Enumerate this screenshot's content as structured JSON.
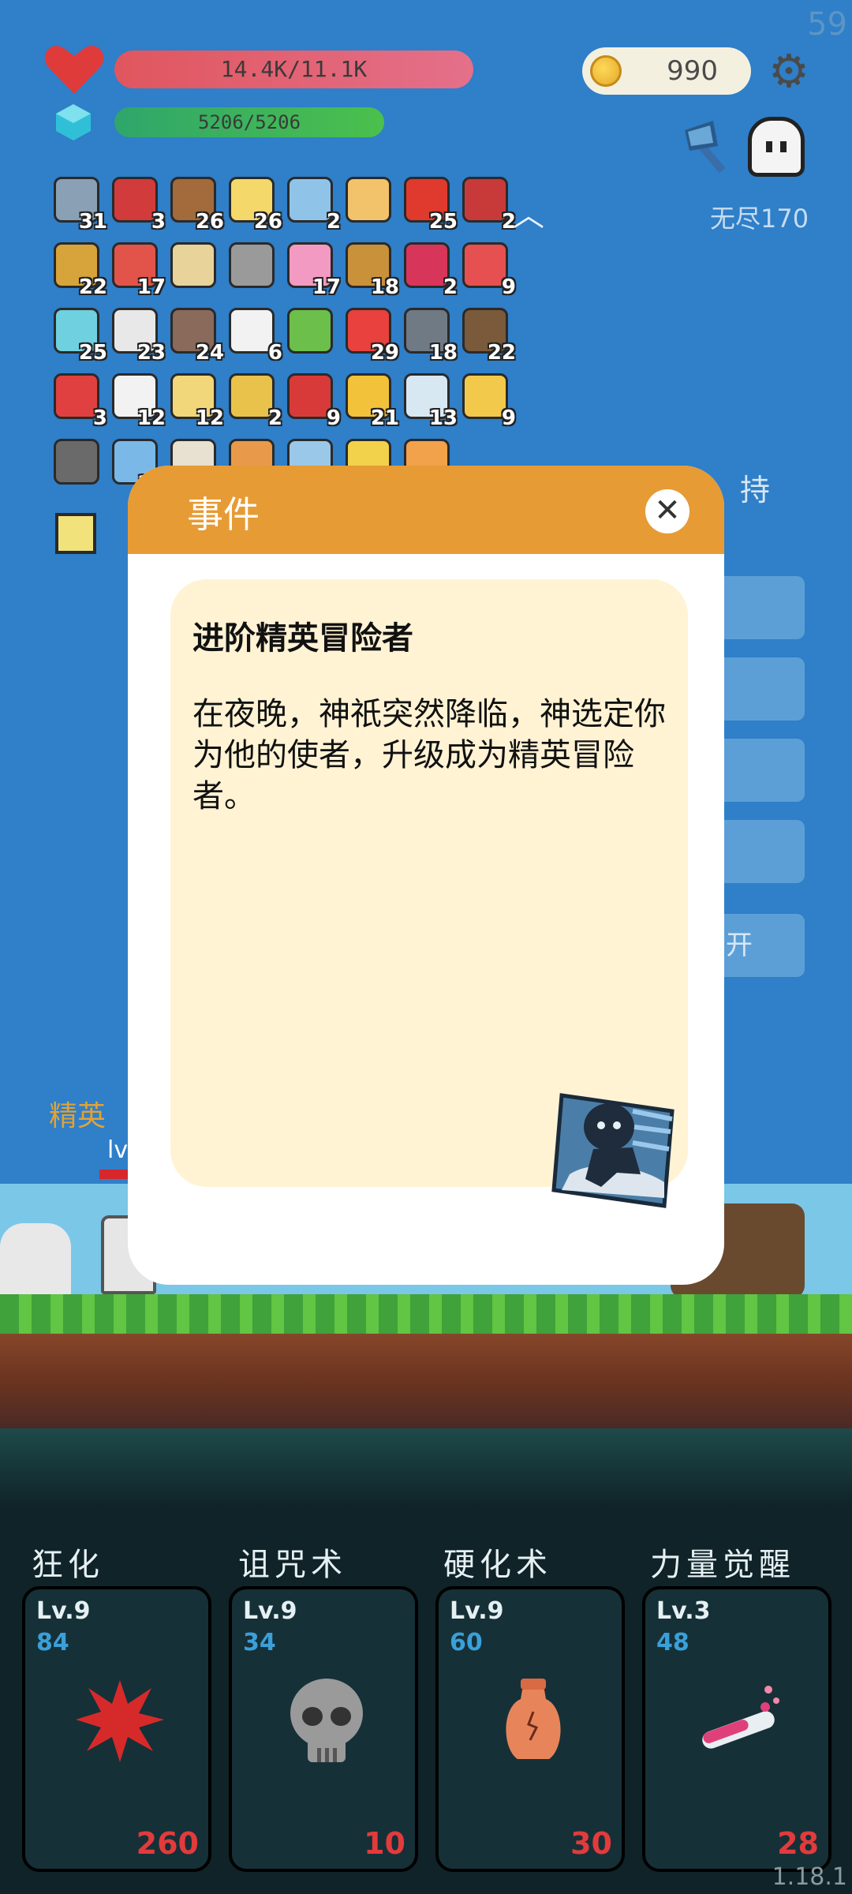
{
  "fps": "59",
  "version": "1.18.1",
  "hud": {
    "hp_text": "14.4K/11.1K",
    "mp_text": "5206/5206",
    "gold": "990",
    "endless_label": "无尽170"
  },
  "items": [
    {
      "name": "sword",
      "count": "31",
      "color": "#8aa0b4"
    },
    {
      "name": "magnet",
      "count": "3",
      "color": "#d23b3b"
    },
    {
      "name": "round-shield",
      "count": "26",
      "color": "#a36a3b"
    },
    {
      "name": "flower",
      "count": "26",
      "color": "#f4d86a"
    },
    {
      "name": "shirt",
      "count": "2",
      "color": "#8fc4e8"
    },
    {
      "name": "short-sword",
      "count": "",
      "color": "#f2c36b"
    },
    {
      "name": "apple",
      "count": "25",
      "color": "#e03a2e"
    },
    {
      "name": "red-shield",
      "count": "2",
      "color": "#c83a3a"
    },
    {
      "name": "durian",
      "count": "22",
      "color": "#d6a43a"
    },
    {
      "name": "watermelon",
      "count": "17",
      "color": "#e2544a"
    },
    {
      "name": "scroll",
      "count": "",
      "color": "#e8d39a"
    },
    {
      "name": "viking-helmet",
      "count": "",
      "color": "#9a9a9a"
    },
    {
      "name": "ice-cream",
      "count": "17",
      "color": "#f39ac2"
    },
    {
      "name": "book",
      "count": "18",
      "color": "#c8913a"
    },
    {
      "name": "gem",
      "count": "2",
      "color": "#d8355a"
    },
    {
      "name": "pill",
      "count": "9",
      "color": "#e65050"
    },
    {
      "name": "feather",
      "count": "25",
      "color": "#6fd0e0"
    },
    {
      "name": "envelope",
      "count": "23",
      "color": "#e8e8e8"
    },
    {
      "name": "door",
      "count": "24",
      "color": "#8a6a5a"
    },
    {
      "name": "dice",
      "count": "6",
      "color": "#f2f2f2"
    },
    {
      "name": "green-card",
      "count": "",
      "color": "#6bbf4a"
    },
    {
      "name": "strawberry",
      "count": "29",
      "color": "#e8413e"
    },
    {
      "name": "spiked-ball",
      "count": "18",
      "color": "#707a84"
    },
    {
      "name": "coconut",
      "count": "22",
      "color": "#7a5a3a"
    },
    {
      "name": "sock",
      "count": "3",
      "color": "#e04040"
    },
    {
      "name": "ghost",
      "count": "12",
      "color": "#f2f2f2"
    },
    {
      "name": "note",
      "count": "12",
      "color": "#f2d77a"
    },
    {
      "name": "ring",
      "count": "2",
      "color": "#e8c24a"
    },
    {
      "name": "bookmark",
      "count": "9",
      "color": "#d83a3a"
    },
    {
      "name": "battery",
      "count": "21",
      "color": "#f2c23a"
    },
    {
      "name": "molecule",
      "count": "13",
      "color": "#d8e8f2"
    },
    {
      "name": "cheese",
      "count": "9",
      "color": "#f2c94a"
    },
    {
      "name": "mortar",
      "count": "",
      "color": "#6a6a6a"
    },
    {
      "name": "orb",
      "count": "10",
      "color": "#7ab8e8"
    },
    {
      "name": "cards",
      "count": "",
      "color": "#e8e0d0"
    },
    {
      "name": "bag",
      "count": "",
      "color": "#e89a4a"
    },
    {
      "name": "frame",
      "count": "",
      "color": "#9ac8e8"
    },
    {
      "name": "lamp",
      "count": "",
      "color": "#f2d24a"
    },
    {
      "name": "crown",
      "count": "",
      "color": "#f2a24a"
    }
  ],
  "side_menu": {
    "visible_text_1": "持",
    "visible_text_2": "开"
  },
  "battle": {
    "elite_label": "精英",
    "level_label": "lv"
  },
  "skills": [
    {
      "name": "狂化",
      "level": "Lv.9",
      "mp": "84",
      "cost": "260",
      "icon": "blood-splat-icon"
    },
    {
      "name": "诅咒术",
      "level": "Lv.9",
      "mp": "34",
      "cost": "10",
      "icon": "skull-icon"
    },
    {
      "name": "硬化术",
      "level": "Lv.9",
      "mp": "60",
      "cost": "30",
      "icon": "vase-icon"
    },
    {
      "name": "力量觉醒",
      "level": "Lv.3",
      "mp": "48",
      "cost": "28",
      "icon": "potion-icon"
    }
  ],
  "modal": {
    "header_title": "事件",
    "event_title": "进阶精英冒险者",
    "event_body": "在夜晚，神祇突然降临，神选定你为他的使者，升级成为精英冒险者。",
    "close_symbol": "✕"
  }
}
